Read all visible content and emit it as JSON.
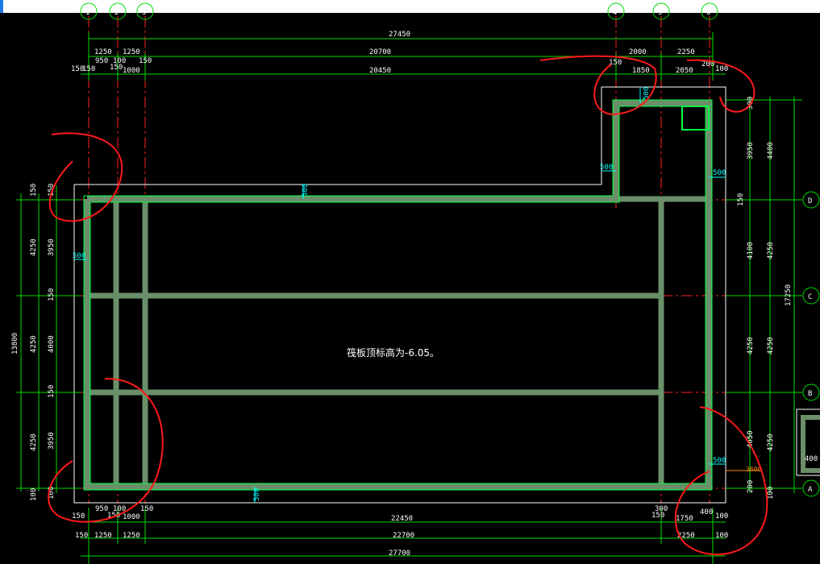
{
  "colors": {
    "background": "#000000",
    "dimension": "#00dd00",
    "wall_fill": "#6a8f6a",
    "wall_edge": "#00ff44",
    "axis": "#ff2020",
    "outline": "#ffffff",
    "markup": "#ff1a1a",
    "callout": "#00ffff",
    "callout_orange": "#ff8800"
  },
  "note": "筏板顶标高为-6.05。",
  "axes": {
    "vertical": [
      "1",
      "2",
      "3",
      "4",
      "5",
      "6"
    ],
    "horizontal": [
      "D",
      "C",
      "B",
      "A"
    ]
  },
  "dims": {
    "top_total": "27450",
    "top_row2": [
      "1250",
      "1250",
      "20700",
      "2000",
      "2250"
    ],
    "top_row3": [
      "150",
      "950",
      "100",
      "150",
      "1000",
      "150",
      "150",
      "20450",
      "150",
      "1850",
      "2050",
      "200",
      "100"
    ],
    "bottom_row1": [
      "150",
      "950",
      "100",
      "150",
      "1000",
      "150",
      "22450",
      "300",
      "150",
      "1750",
      "400",
      "100"
    ],
    "bottom_row2": [
      "150",
      "1250",
      "1250",
      "22700",
      "2250",
      "100"
    ],
    "bottom_total": "27700",
    "left_outer": "13800",
    "left_mid": [
      "4250",
      "4250",
      "4250"
    ],
    "left_inner": [
      "150",
      "150",
      "3950",
      "150",
      "4000",
      "150",
      "3950",
      "100",
      "100"
    ],
    "right_inner": [
      "300",
      "3950",
      "150",
      "4100",
      "4250",
      "4050",
      "200",
      "100"
    ],
    "right_mid": [
      "4400",
      "4250",
      "4250",
      "4250"
    ],
    "right_total": "17250"
  },
  "callouts": {
    "wall_thickness": "500",
    "orange": "3600",
    "side": "400"
  }
}
